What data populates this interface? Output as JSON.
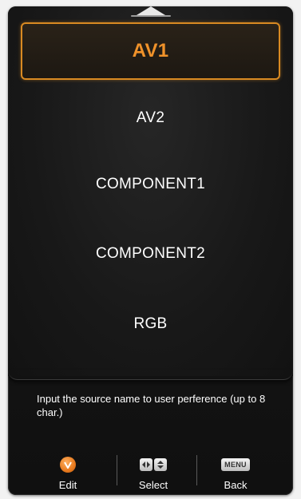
{
  "menu": {
    "items": [
      {
        "label": "AV1",
        "selected": true
      },
      {
        "label": "AV2",
        "selected": false
      },
      {
        "label": "COMPONENT1",
        "selected": false
      },
      {
        "label": "COMPONENT2",
        "selected": false
      },
      {
        "label": "RGB",
        "selected": false
      }
    ]
  },
  "help": {
    "text": "Input the source name to user perference (up to 8 char.)"
  },
  "footer": {
    "edit_label": "Edit",
    "select_label": "Select",
    "back_label": "Back",
    "menu_key_label": "MENU"
  },
  "colors": {
    "accent": "#f0922a",
    "text": "#ffffff",
    "panel": "#151515"
  },
  "icons": {
    "scroll": "scroll-up-arrow-icon",
    "edit": "v-button-icon",
    "select_left_right": "left-right-arrows-icon",
    "select_up_down": "up-down-arrows-icon",
    "back": "menu-key-icon"
  }
}
